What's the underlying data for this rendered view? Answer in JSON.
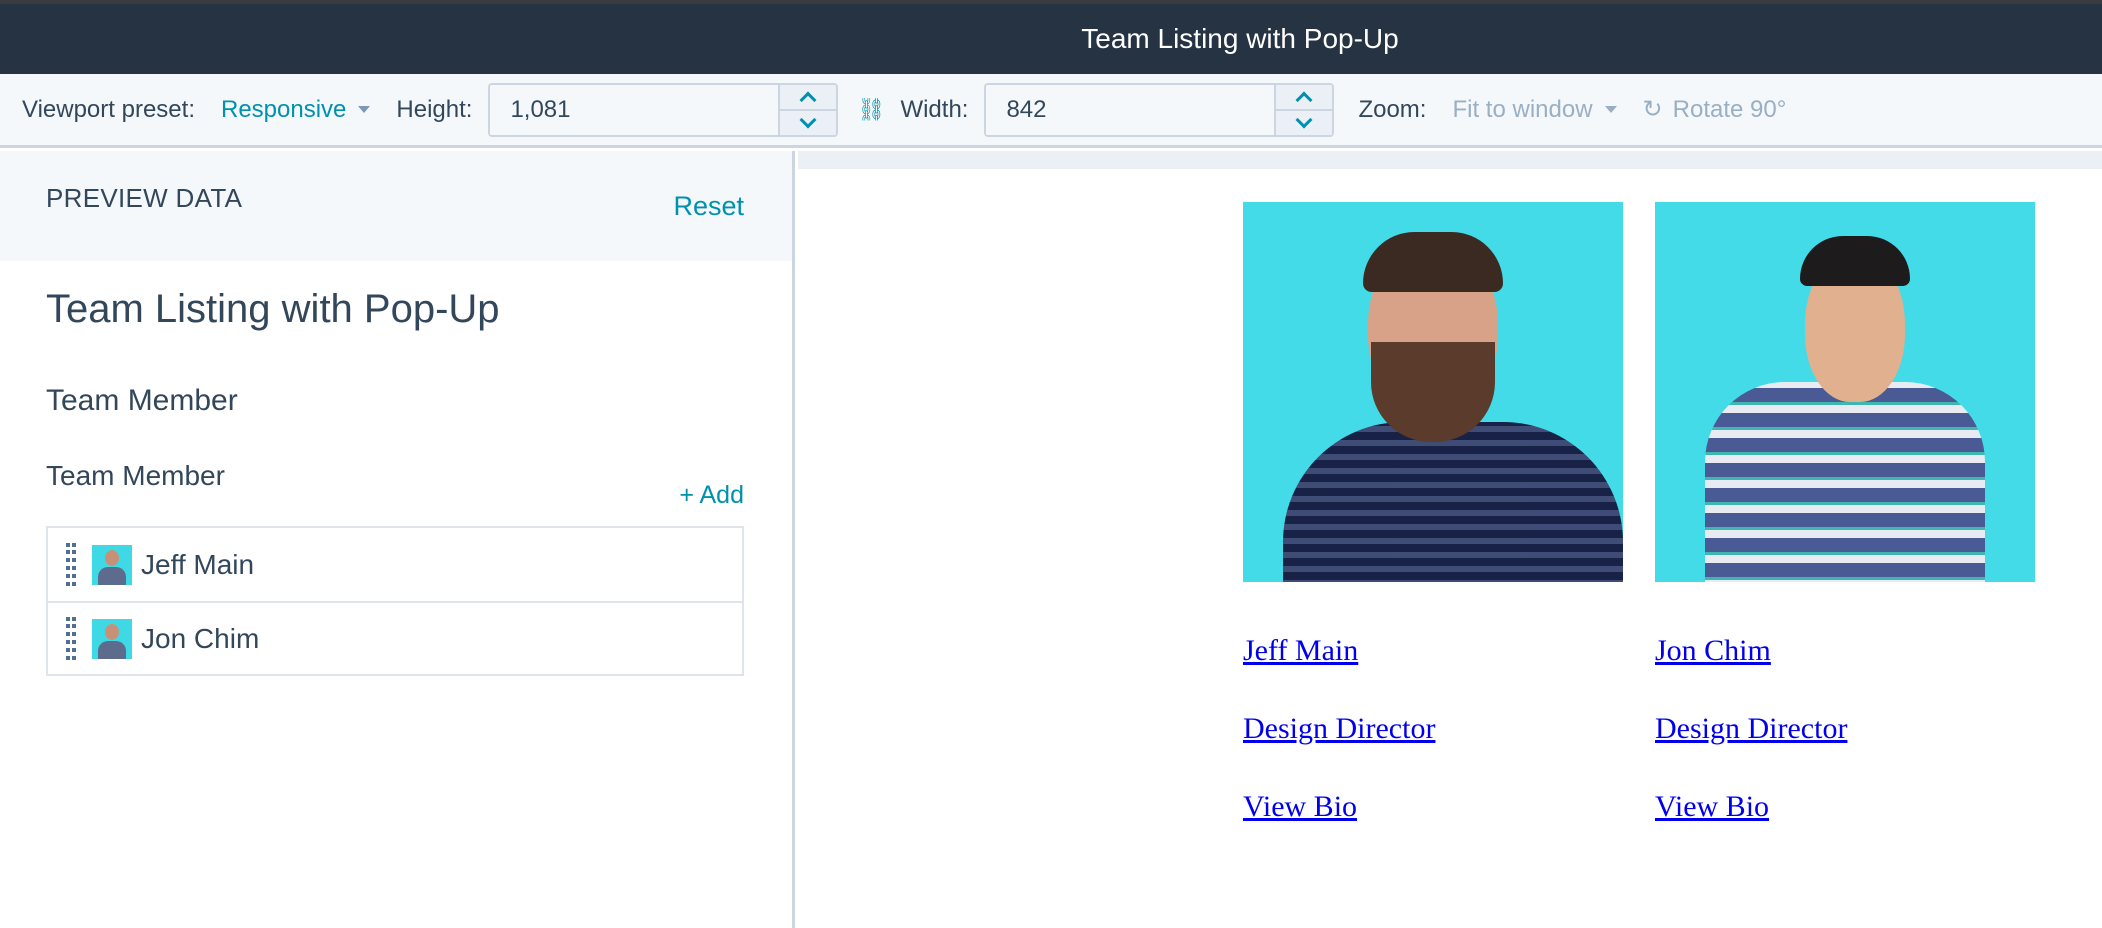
{
  "window": {
    "title": "Team Listing with Pop-Up"
  },
  "toolbar": {
    "viewport_preset_label": "Viewport preset:",
    "viewport_preset_value": "Responsive",
    "height_label": "Height:",
    "height_value": "1,081",
    "width_label": "Width:",
    "width_value": "842",
    "zoom_label": "Zoom:",
    "zoom_value": "Fit to window",
    "rotate_label": "Rotate 90°",
    "link_icon": "link-dimensions-icon",
    "rotate_icon": "rotate-icon"
  },
  "sidebar": {
    "header": "PREVIEW DATA",
    "reset_label": "Reset",
    "module_title": "Team Listing with Pop-Up",
    "group_title": "Team Member",
    "field_label": "Team Member",
    "add_label": "+ Add",
    "members": [
      {
        "name": "Jeff Main"
      },
      {
        "name": "Jon Chim"
      }
    ]
  },
  "preview": {
    "cards": [
      {
        "name": "Jeff Main",
        "role": "Design Director",
        "bio_link": "View Bio"
      },
      {
        "name": "Jon Chim",
        "role": "Design Director",
        "bio_link": "View Bio"
      }
    ]
  },
  "colors": {
    "titlebar_bg": "#253342",
    "accent": "#0091ae",
    "text": "#33475b",
    "link": "#0000ee",
    "photo_bg": "#43dbe8"
  }
}
